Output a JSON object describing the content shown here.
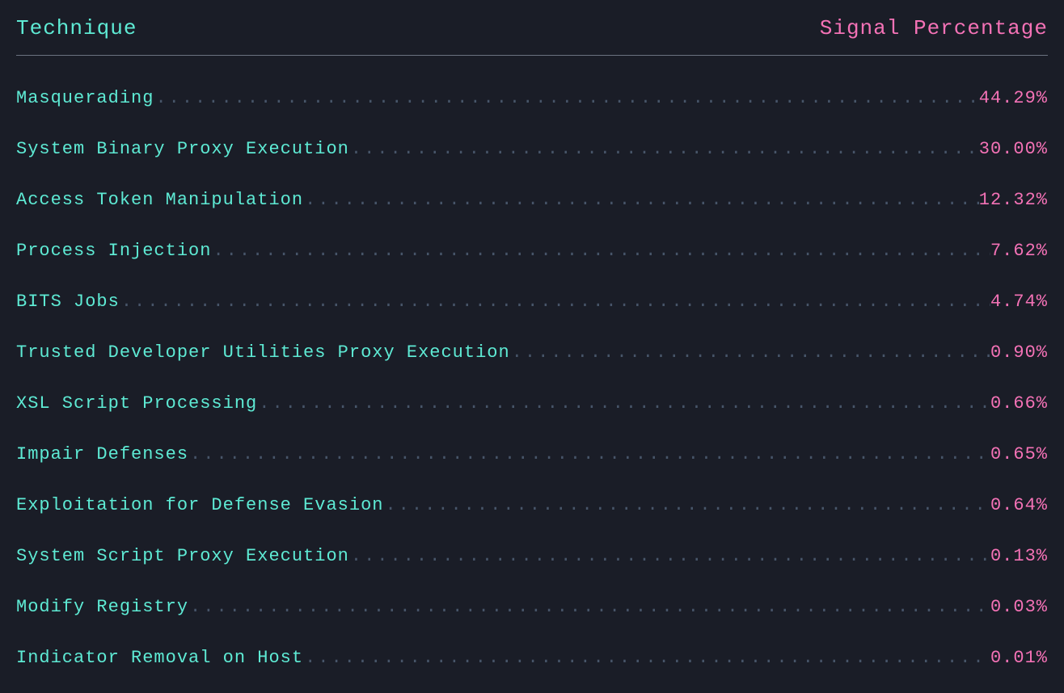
{
  "header": {
    "technique_label": "Technique",
    "percentage_label": "Signal Percentage"
  },
  "chart_data": {
    "type": "table",
    "title": "Technique Signal Percentage",
    "xlabel": "Technique",
    "ylabel": "Signal Percentage",
    "categories": [
      "Masquerading",
      "System Binary Proxy Execution",
      "Access Token Manipulation",
      "Process Injection",
      "BITS Jobs",
      "Trusted Developer Utilities Proxy Execution",
      "XSL Script Processing",
      "Impair Defenses",
      "Exploitation for Defense Evasion",
      "System Script Proxy Execution",
      "Modify Registry",
      "Indicator Removal on Host"
    ],
    "values": [
      44.29,
      30.0,
      12.32,
      7.62,
      4.74,
      0.9,
      0.66,
      0.65,
      0.64,
      0.13,
      0.03,
      0.01
    ],
    "display_values": [
      "44.29%",
      "30.00%",
      "12.32%",
      "7.62%",
      "4.74%",
      "0.90%",
      "0.66%",
      "0.65%",
      "0.64%",
      "0.13%",
      "0.03%",
      "0.01%"
    ]
  }
}
